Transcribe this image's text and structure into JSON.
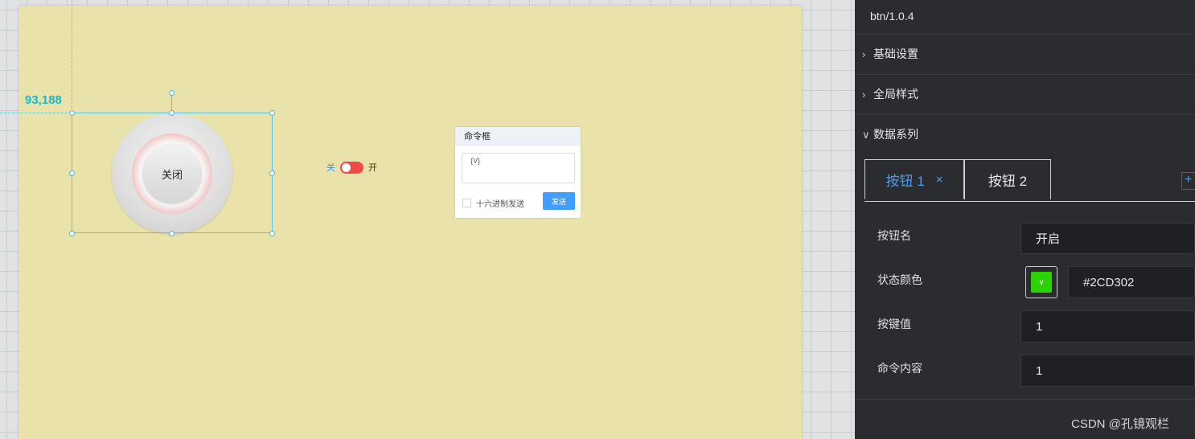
{
  "canvas": {
    "coord_label": "93,188",
    "knob_label": "关闭",
    "switch": {
      "off_label": "关",
      "on_label": "开"
    },
    "command_box": {
      "title": "命令框",
      "textarea_value": "{V}",
      "hex_checkbox_label": "十六进制发送",
      "send_label": "发送"
    }
  },
  "panel": {
    "version": "btn/1.0.4",
    "sections": [
      {
        "label": "基础设置",
        "expanded": false
      },
      {
        "label": "全局样式",
        "expanded": false
      },
      {
        "label": "数据系列",
        "expanded": true
      }
    ],
    "tabs": [
      {
        "label": "按钮 1",
        "active": true,
        "close": "×"
      },
      {
        "label": "按钮 2",
        "active": false
      }
    ],
    "add_label": "+",
    "fields": {
      "name_label": "按钮名",
      "name_value": "开启",
      "color_label": "状态颜色",
      "color_value": "#2CD302",
      "color_swatch": "#2CD302",
      "key_label": "按键值",
      "key_value": "1",
      "cmd_label": "命令内容",
      "cmd_value": "1"
    }
  },
  "watermark": "CSDN @孔镜观栏"
}
